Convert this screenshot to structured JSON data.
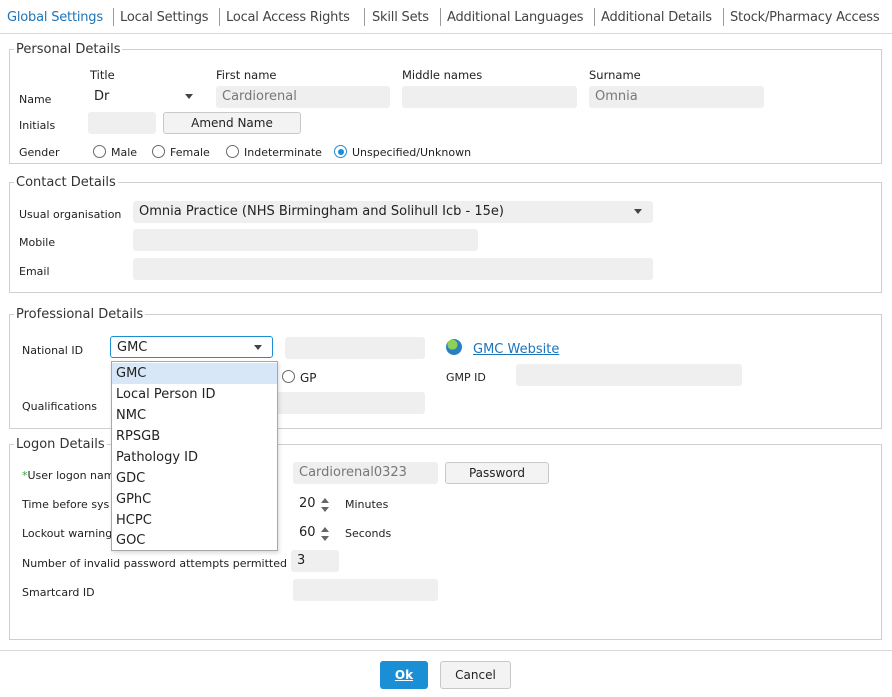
{
  "tabs": [
    {
      "label": "Global Settings"
    },
    {
      "label": "Local Settings"
    },
    {
      "label": "Local Access Rights"
    },
    {
      "label": "Skill Sets"
    },
    {
      "label": "Additional Languages"
    },
    {
      "label": "Additional Details"
    },
    {
      "label": "Stock/Pharmacy Access"
    }
  ],
  "personal": {
    "legend": "Personal Details",
    "hdr_title": "Title",
    "hdr_first": "First name",
    "hdr_middle": "Middle names",
    "hdr_surname": "Surname",
    "name_label": "Name",
    "title_value": "Dr",
    "first_value": "Cardiorenal",
    "middle_value": "",
    "surname_value": "Omnia",
    "initials_label": "Initials",
    "initials_value": "",
    "amend_button": "Amend Name",
    "gender_label": "Gender",
    "gender_options": [
      "Male",
      "Female",
      "Indeterminate",
      "Unspecified/Unknown"
    ],
    "gender_selected": "Unspecified/Unknown"
  },
  "contact": {
    "legend": "Contact Details",
    "org_label": "Usual organisation",
    "org_value": "Omnia Practice (NHS Birmingham and Solihull Icb - 15e)",
    "mobile_label": "Mobile",
    "mobile_value": "",
    "email_label": "Email",
    "email_value": ""
  },
  "professional": {
    "legend": "Professional Details",
    "national_id_label": "National ID",
    "national_id_value": "GMC",
    "national_id_number": "",
    "website_link": "GMC Website",
    "gp_label": "GP",
    "gmp_id_label": "GMP ID",
    "gmp_id_value": "",
    "qualifications_label": "Qualifications",
    "qualifications_value": "",
    "dropdown_options": [
      "GMC",
      "Local Person ID",
      "NMC",
      "RPSGB",
      "Pathology ID",
      "GDC",
      "GPhC",
      "HCPC",
      "GOC"
    ]
  },
  "logon": {
    "legend": "Logon Details",
    "user_logon_label": "User logon nam",
    "user_logon_value": "Cardiorenal0323",
    "password_button": "Password",
    "time_before_label": "Time before sys",
    "time_before_value": "20",
    "time_before_unit": "Minutes",
    "lockout_label": "Lockout warning",
    "lockout_value": "60",
    "lockout_unit": "Seconds",
    "invalid_attempts_label": "Number of invalid password attempts permitted",
    "invalid_attempts_value": "3",
    "smartcard_label": "Smartcard ID",
    "smartcard_value": ""
  },
  "footer": {
    "ok": "Ok",
    "cancel": "Cancel"
  },
  "colors": {
    "accent": "#1a8fd6",
    "tab_active": "#1b75bb"
  }
}
